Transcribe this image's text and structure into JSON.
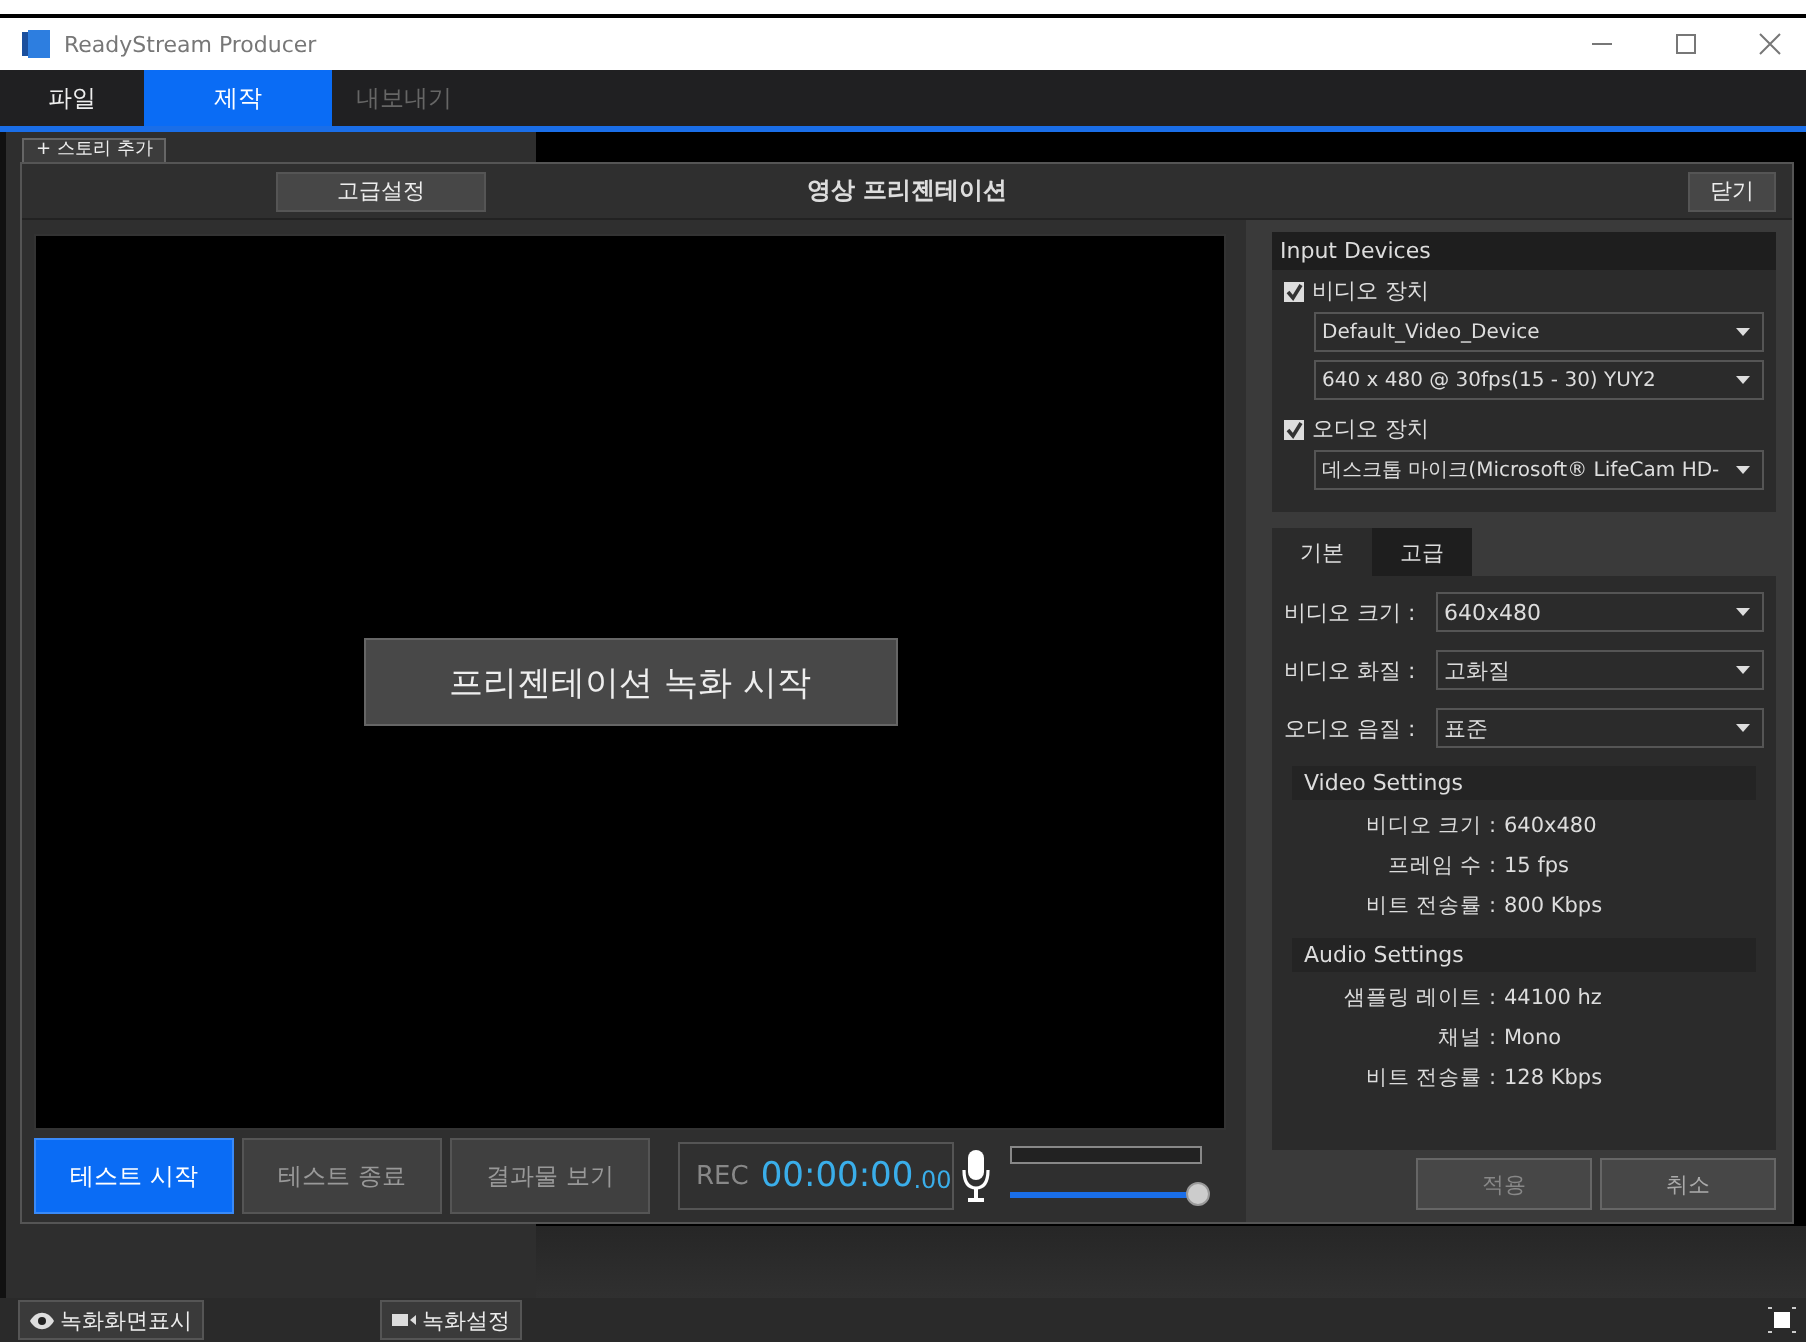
{
  "window": {
    "title": "ReadyStream Producer"
  },
  "menu_tabs": [
    {
      "label": "파일",
      "selected": false,
      "disabled": false
    },
    {
      "label": "제작",
      "selected": true,
      "disabled": false
    },
    {
      "label": "내보내기",
      "selected": false,
      "disabled": true
    }
  ],
  "story_button": "+ 스토리 추가",
  "dialog": {
    "title": "영상 프리젠테이션",
    "advanced_button": "고급설정",
    "close_button": "닫기",
    "start_button": "프리젠테이션 녹화 시작",
    "controls": [
      {
        "label": "테스트 시작",
        "disabled": false
      },
      {
        "label": "테스트 종료",
        "disabled": true
      },
      {
        "label": "결과물 보기",
        "disabled": true
      }
    ],
    "rec_label": "REC",
    "timer": "00:00:00",
    "timer_fraction": ".00",
    "mic_volume": {
      "level": 1
    },
    "input_devices": {
      "title": "Input Devices",
      "devices": [
        {
          "label": "비디오 장치",
          "checked": true,
          "selects": [
            "Default_Video_Device",
            "640 x 480 @ 30fps(15 - 30) YUY2"
          ]
        },
        {
          "label": "오디오 장치",
          "checked": true,
          "selects": [
            "데스크톱 마이크(Microsoft® LifeCam HD-"
          ]
        }
      ]
    },
    "settings_tabs": [
      {
        "label": "기본",
        "selected": true
      },
      {
        "label": "고급",
        "selected": false
      }
    ],
    "fields": [
      {
        "label": "비디오 크기 :",
        "value": "640x480"
      },
      {
        "label": "비디오 화질 :",
        "value": "고화질"
      },
      {
        "label": "오디오 음질 :",
        "value": "표준"
      }
    ],
    "summaries": [
      {
        "title": "Video Settings",
        "rows": [
          {
            "label": "비디오 크기 :",
            "value": "640x480"
          },
          {
            "label": "프레임 수 :",
            "value": "15 fps"
          },
          {
            "label": "비트 전송률 :",
            "value": "800 Kbps"
          }
        ]
      },
      {
        "title": "Audio Settings",
        "rows": [
          {
            "label": "샘플링 레이트 :",
            "value": "44100 hz"
          },
          {
            "label": "채널 :",
            "value": "Mono"
          },
          {
            "label": "비트 전송률 :",
            "value": "128 Kbps"
          }
        ]
      }
    ],
    "apply_button": "적용",
    "cancel_button": "취소"
  },
  "bottom_buttons": [
    {
      "kind": "view",
      "label": "녹화화면표시"
    },
    {
      "kind": "settings",
      "label": "녹화설정"
    }
  ]
}
